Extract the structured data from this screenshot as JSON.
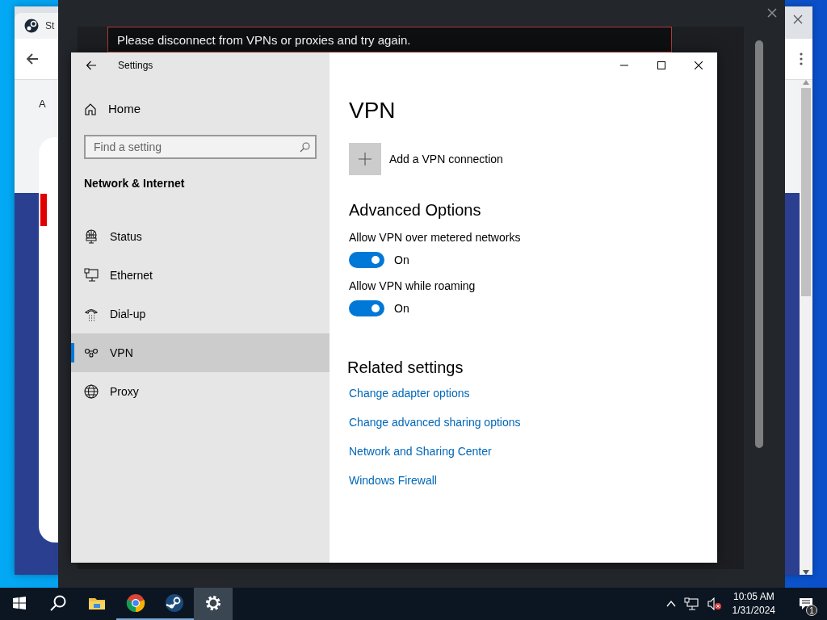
{
  "browser": {
    "tab_title": "St",
    "content_text": "A"
  },
  "overlay": {
    "error_message": "Please disconnect from VPNs or proxies and try again."
  },
  "settings": {
    "window_title": "Settings",
    "home": "Home",
    "search": {
      "placeholder": "Find a setting"
    },
    "section": "Network & Internet",
    "nav": [
      {
        "label": "Status",
        "kind": "status",
        "selected": false
      },
      {
        "label": "Ethernet",
        "kind": "ethernet",
        "selected": false
      },
      {
        "label": "Dial-up",
        "kind": "dialup",
        "selected": false
      },
      {
        "label": "VPN",
        "kind": "vpn",
        "selected": true
      },
      {
        "label": "Proxy",
        "kind": "proxy",
        "selected": false
      }
    ],
    "page_title": "VPN",
    "add_vpn": "Add a VPN connection",
    "advanced_heading": "Advanced Options",
    "toggles": [
      {
        "label": "Allow VPN over metered networks",
        "on": true,
        "state_text": "On"
      },
      {
        "label": "Allow VPN while roaming",
        "on": true,
        "state_text": "On"
      }
    ],
    "related_heading": "Related settings",
    "links": [
      "Change adapter options",
      "Change advanced sharing options",
      "Network and Sharing Center",
      "Windows Firewall"
    ]
  },
  "taskbar": {
    "apps": [
      {
        "kind": "files",
        "running": false,
        "selected": false
      },
      {
        "kind": "chrome",
        "running": true,
        "selected": false
      },
      {
        "kind": "steam",
        "running": true,
        "selected": false
      },
      {
        "kind": "settings",
        "running": false,
        "selected": true
      }
    ],
    "time": "10:05 AM",
    "date": "1/31/2024",
    "notification_count": "1"
  }
}
